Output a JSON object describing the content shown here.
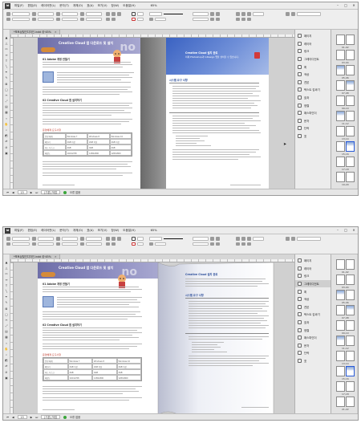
{
  "app": {
    "logo": "Id",
    "menus": [
      "파일(F)",
      "편집(E)",
      "레이아웃(L)",
      "문자(T)",
      "개체(O)",
      "표(A)",
      "보기(V)",
      "창(W)",
      "도움말(H)"
    ],
    "zoom": "65%",
    "window_controls": {
      "minimize": "–",
      "maximize": "□",
      "close": "✕"
    }
  },
  "document": {
    "tab_label": "*포토샵및인디자인.indd @ 65%"
  },
  "statusbar": {
    "page_number": "15",
    "page_name": "[기본] 작업",
    "preflight": "오류 없음"
  },
  "panel": {
    "items": [
      {
        "icon": "pages-icon",
        "label": "페이지"
      },
      {
        "icon": "layers-icon",
        "label": "레이어"
      },
      {
        "icon": "links-icon",
        "label": "링크"
      },
      {
        "icon": "gradient-icon",
        "label": "그레이디언트"
      },
      {
        "icon": "stroke-icon",
        "label": "획"
      },
      {
        "icon": "color-icon",
        "label": "색상"
      },
      {
        "icon": "swatches-icon",
        "label": "견본"
      },
      {
        "icon": "text-wrap-icon",
        "label": "텍스트 감싸기"
      },
      {
        "icon": "effects-icon",
        "label": "효과"
      },
      {
        "icon": "align-icon",
        "label": "정렬"
      },
      {
        "icon": "pathfinder-icon",
        "label": "패스파인더"
      },
      {
        "icon": "character-icon",
        "label": "문자"
      },
      {
        "icon": "paragraph-icon",
        "label": "단락"
      },
      {
        "icon": "table-icon",
        "label": "표"
      }
    ],
    "active_index_bottom": 3
  },
  "pages_panel": {
    "labels": [
      "01-02",
      "03-04",
      "05-06",
      "07-08",
      "09-10",
      "11-12",
      "13-14",
      "15-16",
      "17-18",
      "19-20",
      "21-22"
    ]
  },
  "spread_left": {
    "header_title": "Creative Cloud 앱 다운로드 및 설치",
    "header_big": "no",
    "section1": "01 Adobe 계정 만들기",
    "section2": "02 Creative Cloud 앱 설치하기",
    "table_caption": "운영체제 요구사항",
    "table": [
      [
        "운영 체제",
        "Windows 7",
        "Windows 8",
        "Windows 10"
      ],
      [
        "메모리",
        "2GB 이상",
        "2GB 이상",
        "4GB 이상"
      ],
      [
        "하드 디스크",
        "4GB",
        "4GB",
        "4GB"
      ],
      [
        "해상도",
        "1024x768",
        "1280x800",
        "1280x800"
      ]
    ]
  },
  "spread_right": {
    "blue_title": "Creative Cloud 설치 완료",
    "blue_sub": "이제 Photoshop과 InDesign 앱을 설치할 수 있습니다.",
    "section": "시스템 요구 사항"
  }
}
